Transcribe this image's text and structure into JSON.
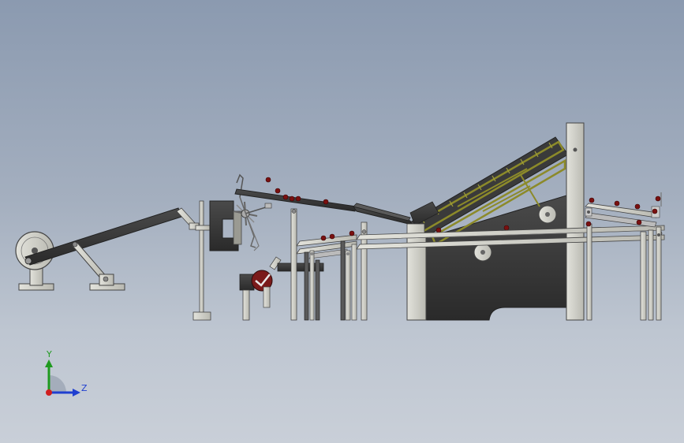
{
  "viewport": {
    "background_top": "#8b9ab0",
    "background_bottom": "#c9cfd8"
  },
  "colors": {
    "frame_light": "#cfcfc6",
    "frame_stroke": "#4a4a4a",
    "dark_metal": "#3b3b3b",
    "chain_yellow": "#8c8a2a",
    "fruit_red": "#7a1010",
    "axis_y": "#1f9a1f",
    "axis_z": "#1f3fd0",
    "axis_x": "#d01f1f"
  },
  "triad": {
    "y_label": "Y",
    "z_label": "Z",
    "y_color": "#1f9a1f",
    "z_color": "#1f3fd0",
    "x_color": "#d01f1f",
    "origin_icon": "origin-dot-icon"
  }
}
